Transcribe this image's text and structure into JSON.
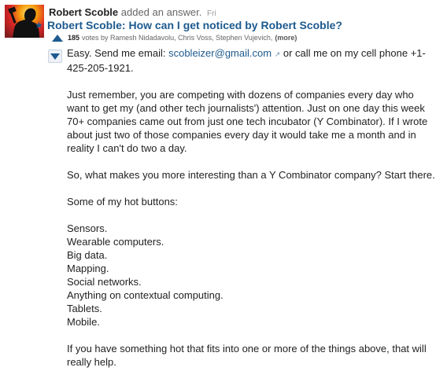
{
  "author": {
    "name": "Robert Scoble",
    "action": "added an answer.",
    "time": "Fri"
  },
  "question": {
    "title": "Robert Scoble: How can I get noticed by Robert Scoble?"
  },
  "votes": {
    "count": "185",
    "label": "votes by Ramesh Nidadavolu, Chris Voss, Stephen Vujevich,",
    "more": "(more)"
  },
  "answer": {
    "intro_before": "Easy. Send me email: ",
    "email": "scobleizer@gmail.com",
    "ext_icon": "↗",
    "intro_after": " or call me on my cell phone +1-425-205-1921.",
    "para2": "Just remember, you are competing with dozens of companies every day who want to get my (and other tech journalists') attention. Just on one day this week 70+ companies came out from just one tech incubator (Y Combinator). If I wrote about just two of those companies every day it would take me a month and in reality I can't do two a day.",
    "para3": "So, what makes you more interesting than a Y Combinator company? Start there.",
    "para4": "Some of my hot buttons:",
    "hot_buttons": [
      "Sensors.",
      "Wearable computers.",
      "Big data.",
      "Mapping.",
      "Social networks.",
      "Anything on contextual computing.",
      "Tablets.",
      "Mobile."
    ],
    "para5": "If you have something hot that fits into one or more of the things above, that will really help."
  },
  "icons": {
    "star": "★"
  },
  "colors": {
    "link": "#1d5a8e",
    "text": "#222222",
    "muted": "#666666"
  }
}
